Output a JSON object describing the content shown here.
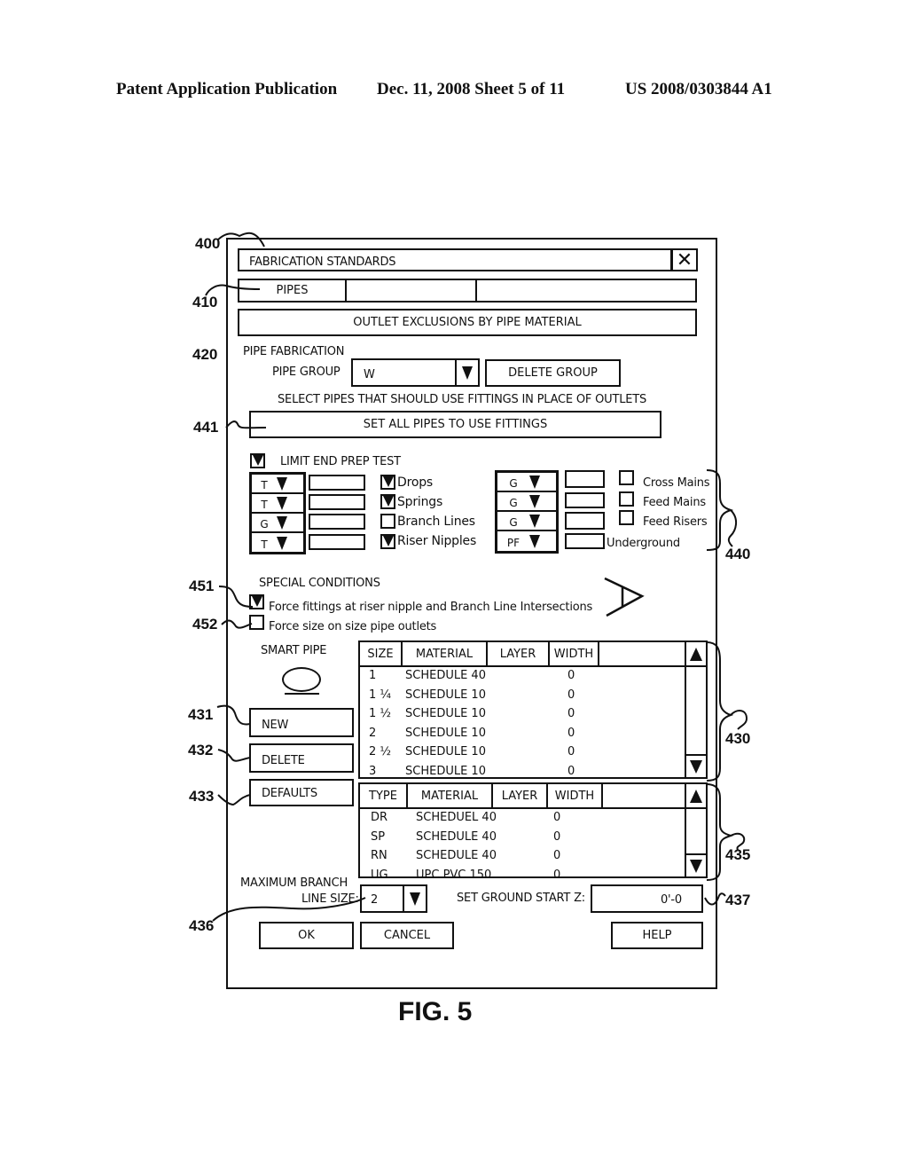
{
  "header": {
    "publication": "Patent Application Publication",
    "date_sheet": "Dec. 11, 2008   Sheet 5 of 11",
    "patent_number": "US 2008/0303844 A1"
  },
  "figure_label": "FIG. 5",
  "refs": {
    "r400": "400",
    "r410": "410",
    "r420": "420",
    "r441": "441",
    "r440": "440",
    "r451": "451",
    "r452": "452",
    "r431": "431",
    "r432": "432",
    "r433": "433",
    "r430": "430",
    "r435": "435",
    "r436": "436",
    "r437": "437"
  },
  "dialog": {
    "title": "FABRICATION STANDARDS",
    "close_icon": "close-icon",
    "tabs": [
      {
        "label": "PIPES"
      },
      {
        "label": ""
      },
      {
        "label": ""
      }
    ],
    "outlet_exclusions_button": "OUTLET EXCLUSIONS BY PIPE MATERIAL",
    "pipe_fabrication_label": "PIPE FABRICATION",
    "pipe_group_label": "PIPE GROUP",
    "pipe_group_value": "W",
    "delete_group_button": "DELETE GROUP",
    "select_pipes_label": "SELECT PIPES THAT SHOULD USE FITTINGS IN PLACE OF OUTLETS",
    "set_all_button": "SET ALL PIPES TO USE FITTINGS",
    "limit_end_prep": {
      "label": "LIMIT END PREP TEST",
      "checked": true
    },
    "left_group": {
      "selects": [
        "T",
        "T",
        "G",
        "T"
      ],
      "inputs": [
        "",
        "",
        "",
        ""
      ],
      "checks": [
        {
          "label": "Drops",
          "checked": true
        },
        {
          "label": "Springs",
          "checked": true
        },
        {
          "label": "Branch Lines",
          "checked": false
        },
        {
          "label": "Riser Nipples",
          "checked": true
        }
      ]
    },
    "right_group": {
      "selects": [
        "G",
        "G",
        "G",
        "PF"
      ],
      "inputs": [
        "",
        "",
        "",
        ""
      ],
      "checks": [
        {
          "label": "Cross Mains",
          "checked": false
        },
        {
          "label": "Feed Mains",
          "checked": false
        },
        {
          "label": "Feed Risers",
          "checked": false
        }
      ],
      "underground_label": "Underground"
    },
    "special_conditions": {
      "label": "SPECIAL CONDITIONS",
      "options": [
        {
          "label": "Force fittings at riser nipple and Branch Line Intersections",
          "checked": true
        },
        {
          "label": "Force size on size pipe outlets",
          "checked": false
        }
      ]
    },
    "smart_pipe_label": "SMART PIPE",
    "buttons_side": {
      "new": "NEW",
      "delete": "DELETE",
      "defaults": "DEFAULTS"
    },
    "size_table": {
      "columns": [
        "SIZE",
        "MATERIAL",
        "LAYER",
        "WIDTH"
      ],
      "rows": [
        {
          "size": "1",
          "material": "SCHEDULE 40",
          "layer": "",
          "width": "0"
        },
        {
          "size": "1 ¼",
          "material": "SCHEDULE 10",
          "layer": "",
          "width": "0"
        },
        {
          "size": "1 ½",
          "material": "SCHEDULE 10",
          "layer": "",
          "width": "0"
        },
        {
          "size": "2",
          "material": "SCHEDULE 10",
          "layer": "",
          "width": "0"
        },
        {
          "size": "2 ½",
          "material": "SCHEDULE 10",
          "layer": "",
          "width": "0"
        },
        {
          "size": "3",
          "material": "SCHEDULE 10",
          "layer": "",
          "width": "0"
        }
      ]
    },
    "type_table": {
      "columns": [
        "TYPE",
        "MATERIAL",
        "LAYER",
        "WIDTH"
      ],
      "rows": [
        {
          "type": "DR",
          "material": "SCHEDUEL 40",
          "layer": "",
          "width": "0"
        },
        {
          "type": "SP",
          "material": "SCHEDULE 40",
          "layer": "",
          "width": "0"
        },
        {
          "type": "RN",
          "material": "SCHEDULE 40",
          "layer": "",
          "width": "0"
        },
        {
          "type": "UG",
          "material": "UPC PVC 150",
          "layer": "",
          "width": "0"
        }
      ]
    },
    "max_branch_label_1": "MAXIMUM BRANCH",
    "max_branch_label_2": "LINE SIZE:",
    "max_branch_value": "2",
    "ground_start_label": "SET GROUND START Z:",
    "ground_start_value": "0'-0",
    "ok_button": "OK",
    "cancel_button": "CANCEL",
    "help_button": "HELP"
  }
}
